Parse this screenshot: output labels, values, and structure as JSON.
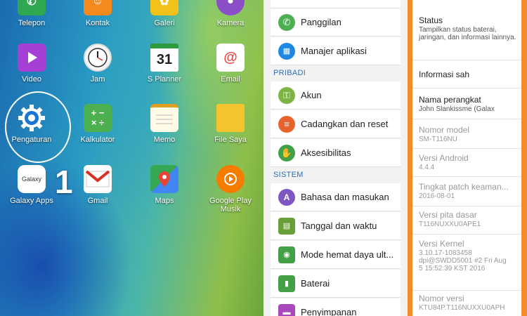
{
  "home": {
    "apps": [
      {
        "label": "Telepon",
        "icon": "phone-icon",
        "color": "#2fa84f"
      },
      {
        "label": "Kontak",
        "icon": "contacts-icon",
        "color": "#f28a1e"
      },
      {
        "label": "Galeri",
        "icon": "gallery-icon",
        "color": "#f3c21a"
      },
      {
        "label": "Kamera",
        "icon": "camera-icon",
        "color": "#8a4fc7"
      },
      {
        "label": "Video",
        "icon": "video-icon",
        "color": "#a63fd6"
      },
      {
        "label": "Jam",
        "icon": "clock-icon",
        "color": "#ffffff"
      },
      {
        "label": "S Planner",
        "icon": "calendar-icon",
        "color": "#ffffff",
        "text": "31"
      },
      {
        "label": "Email",
        "icon": "email-icon",
        "color": "#e84b4b"
      },
      {
        "label": "Pengaturan",
        "icon": "gear-icon",
        "color": "#ffffff"
      },
      {
        "label": "Kalkulator",
        "icon": "calculator-icon",
        "color": "#4caf50"
      },
      {
        "label": "Memo",
        "icon": "memo-icon",
        "color": "#ffffff"
      },
      {
        "label": "File Saya",
        "icon": "folder-icon",
        "color": "#f4c430"
      },
      {
        "label": "Galaxy Apps",
        "icon": "galaxy-apps-icon",
        "color": "#ffffff",
        "text": "Galaxy"
      },
      {
        "label": "Gmail",
        "icon": "gmail-icon",
        "color": "#ffffff"
      },
      {
        "label": "Maps",
        "icon": "maps-icon",
        "color": "#34a853"
      },
      {
        "label": "Google Play Musik",
        "icon": "play-music-icon",
        "color": "#f57c00"
      }
    ],
    "step_number": "1"
  },
  "settings": {
    "items_top": [
      {
        "label": "Panggilan",
        "icon": "call-icon",
        "color": "#4caf50"
      },
      {
        "label": "Manajer aplikasi",
        "icon": "apps-grid-icon",
        "color": "#1e88e5"
      }
    ],
    "section_pribadi": "PRIBADI",
    "items_pribadi": [
      {
        "label": "Akun",
        "icon": "key-icon",
        "color": "#7cb342"
      },
      {
        "label": "Cadangkan dan reset",
        "icon": "backup-icon",
        "color": "#e8622c"
      },
      {
        "label": "Aksesibilitas",
        "icon": "hand-icon",
        "color": "#43a047"
      }
    ],
    "section_sistem": "SISTEM",
    "items_sistem": [
      {
        "label": "Bahasa dan masukan",
        "icon": "language-icon",
        "color": "#7e57c2"
      },
      {
        "label": "Tanggal dan waktu",
        "icon": "date-time-icon",
        "color": "#689f38"
      },
      {
        "label": "Mode hemat daya ult...",
        "icon": "power-saving-icon",
        "color": "#43a047"
      },
      {
        "label": "Baterai",
        "icon": "battery-icon",
        "color": "#43a047"
      },
      {
        "label": "Penyimpanan",
        "icon": "storage-icon",
        "color": "#ab47bc"
      }
    ]
  },
  "device_info": {
    "items": [
      {
        "title": "Status",
        "sub": "Tampilkan status baterai, jaringan, dan informasi lainnya.",
        "dim": false
      },
      {
        "title": "Informasi sah",
        "sub": "",
        "dim": false
      },
      {
        "title": "Nama perangkat",
        "sub": "John Slankissme (Galax",
        "dim": false
      },
      {
        "title": "Nomor model",
        "sub": "SM-T116NU",
        "dim": true
      },
      {
        "title": "Versi Android",
        "sub": "4.4.4",
        "dim": true
      },
      {
        "title": "Tingkat patch keaman...",
        "sub": "2016-08-01",
        "dim": true
      },
      {
        "title": "Versi pita dasar",
        "sub": "T116NUXXU0APE1",
        "dim": true
      },
      {
        "title": "Versi Kernel",
        "sub": "3.10.17-1083458 dpi@SWDD5001 #2 Fri Aug 5 15:52:39 KST 2016",
        "dim": true
      },
      {
        "title": "Nomor versi",
        "sub": "KTU84P.T116NUXXU0APH",
        "dim": true
      }
    ],
    "accent_color": "#f58a2a"
  }
}
